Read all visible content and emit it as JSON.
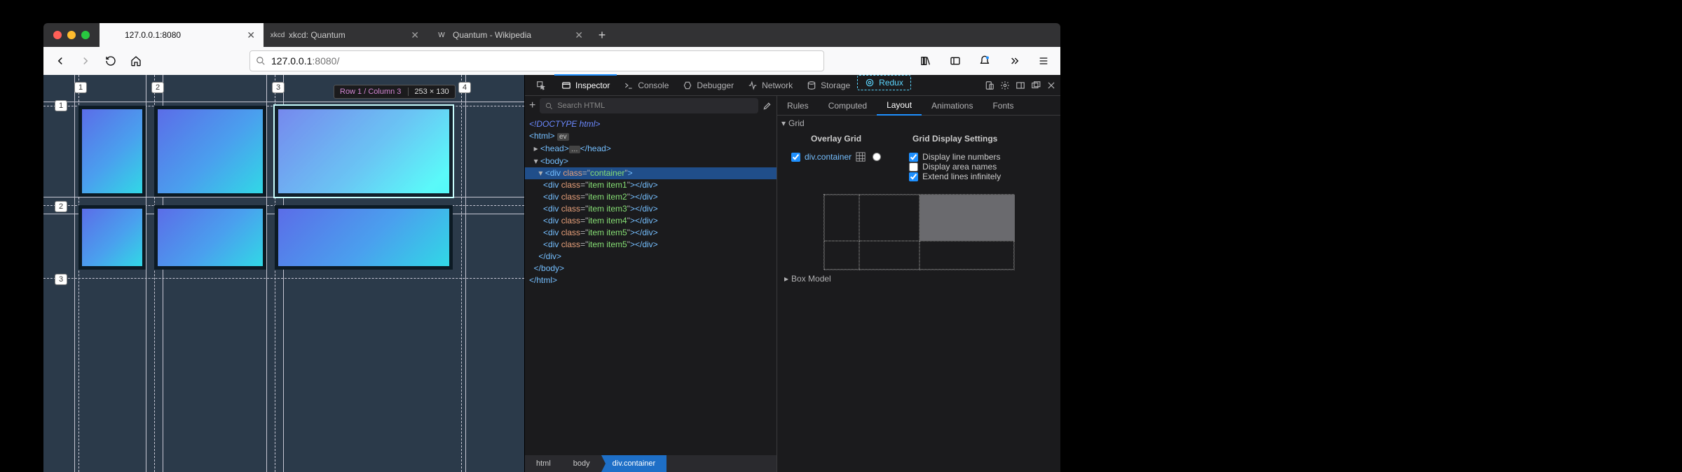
{
  "traffic": {
    "close": "close",
    "min": "min",
    "max": "max"
  },
  "tabs": [
    {
      "title": "127.0.0.1:8080",
      "favicon": "",
      "active": true
    },
    {
      "title": "xkcd: Quantum",
      "favicon": "xkcd",
      "active": false
    },
    {
      "title": "Quantum - Wikipedia",
      "favicon": "W",
      "active": false
    }
  ],
  "newtab_label": "+",
  "url": {
    "host": "127.0.0.1",
    "port": ":8080",
    "path": "/"
  },
  "search_placeholder": "Search HTML",
  "devtools_tabs": [
    "Inspector",
    "Console",
    "Debugger",
    "Network",
    "Storage",
    "Redux"
  ],
  "devtools_active": "Inspector",
  "side_tabs": [
    "Rules",
    "Computed",
    "Layout",
    "Animations",
    "Fonts"
  ],
  "side_active": "Layout",
  "grid_section": "Grid",
  "overlay_title": "Overlay Grid",
  "overlay_item": "div.container",
  "settings_title": "Grid Display Settings",
  "settings": [
    {
      "label": "Display line numbers",
      "checked": true
    },
    {
      "label": "Display area names",
      "checked": false
    },
    {
      "label": "Extend lines infinitely",
      "checked": true
    }
  ],
  "boxmodel_label": "Box Model",
  "breadcrumb": [
    "html",
    "body",
    "div.container"
  ],
  "tooltip": {
    "cell": "Row 1 / Column 3",
    "size": "253 × 130"
  },
  "col_numbers": [
    "1",
    "2",
    "3",
    "4"
  ],
  "row_numbers": [
    "1",
    "2",
    "3"
  ],
  "dom_tree": [
    {
      "indent": 0,
      "html": "<span class='t-doc'>&lt;!DOCTYPE html&gt;</span>"
    },
    {
      "indent": 0,
      "html": "<span class='t-tag'>&lt;html&gt;</span> <span class='t-ev'>ev</span>"
    },
    {
      "indent": 1,
      "html": "▸ <span class='t-tag'>&lt;head&gt;</span><span class='t-ev'>…</span><span class='t-tag'>&lt;/head&gt;</span>"
    },
    {
      "indent": 1,
      "html": "▾ <span class='t-tag'>&lt;body&gt;</span>"
    },
    {
      "indent": 2,
      "sel": true,
      "html": "▾ <span class='t-tag'>&lt;div</span> <span class='t-attr'>class</span>=\"<span class='t-val'>container</span>\"<span class='t-tag'>&gt;</span>"
    },
    {
      "indent": 3,
      "html": "<span class='t-tag'>&lt;div</span> <span class='t-attr'>class</span>=\"<span class='t-val'>item item1</span>\"<span class='t-tag'>&gt;&lt;/div&gt;</span>"
    },
    {
      "indent": 3,
      "html": "<span class='t-tag'>&lt;div</span> <span class='t-attr'>class</span>=\"<span class='t-val'>item item2</span>\"<span class='t-tag'>&gt;&lt;/div&gt;</span>"
    },
    {
      "indent": 3,
      "html": "<span class='t-tag'>&lt;div</span> <span class='t-attr'>class</span>=\"<span class='t-val'>item item3</span>\"<span class='t-tag'>&gt;&lt;/div&gt;</span>"
    },
    {
      "indent": 3,
      "html": "<span class='t-tag'>&lt;div</span> <span class='t-attr'>class</span>=\"<span class='t-val'>item item4</span>\"<span class='t-tag'>&gt;&lt;/div&gt;</span>"
    },
    {
      "indent": 3,
      "html": "<span class='t-tag'>&lt;div</span> <span class='t-attr'>class</span>=\"<span class='t-val'>item item5</span>\"<span class='t-tag'>&gt;&lt;/div&gt;</span>"
    },
    {
      "indent": 3,
      "html": "<span class='t-tag'>&lt;div</span> <span class='t-attr'>class</span>=\"<span class='t-val'>item item5</span>\"<span class='t-tag'>&gt;&lt;/div&gt;</span>"
    },
    {
      "indent": 2,
      "html": "<span class='t-tag'>&lt;/div&gt;</span>"
    },
    {
      "indent": 1,
      "html": "<span class='t-tag'>&lt;/body&gt;</span>"
    },
    {
      "indent": 0,
      "html": "<span class='t-tag'>&lt;/html&gt;</span>"
    }
  ]
}
